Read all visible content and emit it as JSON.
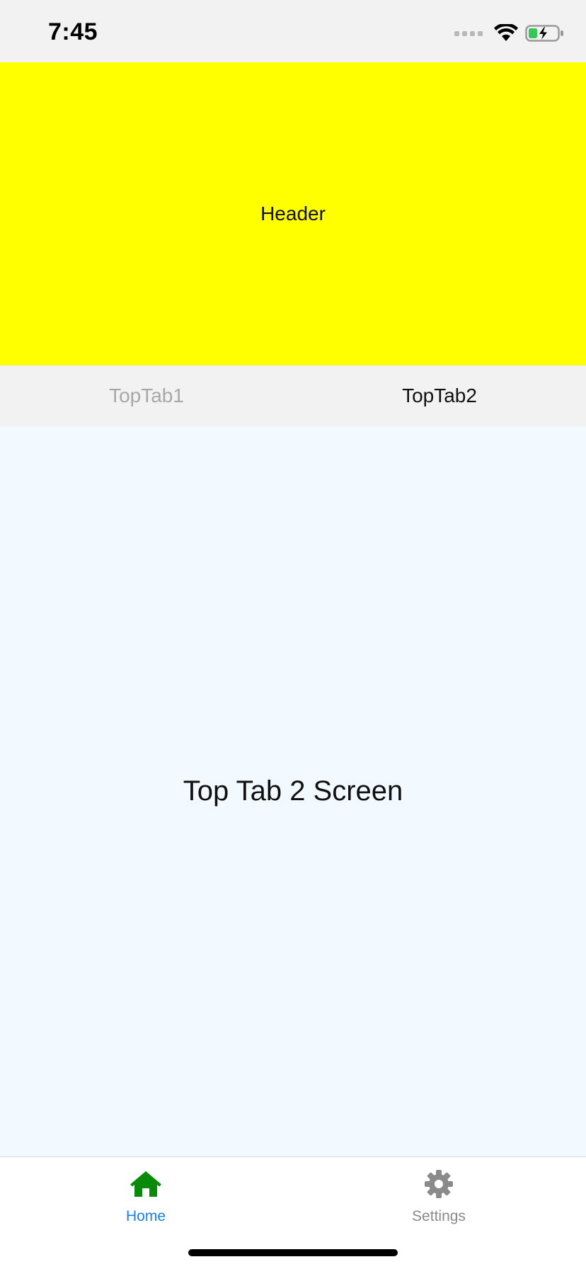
{
  "status_bar": {
    "time": "7:45",
    "icons": [
      "cellular-signal-icon",
      "wifi-icon",
      "battery-charging-icon"
    ],
    "battery_color": "#34c759"
  },
  "header": {
    "title": "Header",
    "background": "#ffff00"
  },
  "top_tabs": {
    "items": [
      {
        "label": "TopTab1",
        "active": false
      },
      {
        "label": "TopTab2",
        "active": true
      }
    ]
  },
  "content": {
    "title": "Top Tab 2 Screen",
    "background": "#f3faff"
  },
  "bottom_tabs": {
    "items": [
      {
        "label": "Home",
        "icon": "home-icon",
        "active": true,
        "icon_color": "#0a8a0a",
        "label_color": "#1a7ff0"
      },
      {
        "label": "Settings",
        "icon": "gear-icon",
        "active": false,
        "icon_color": "#8a8a8a",
        "label_color": "#8a8a8a"
      }
    ]
  }
}
